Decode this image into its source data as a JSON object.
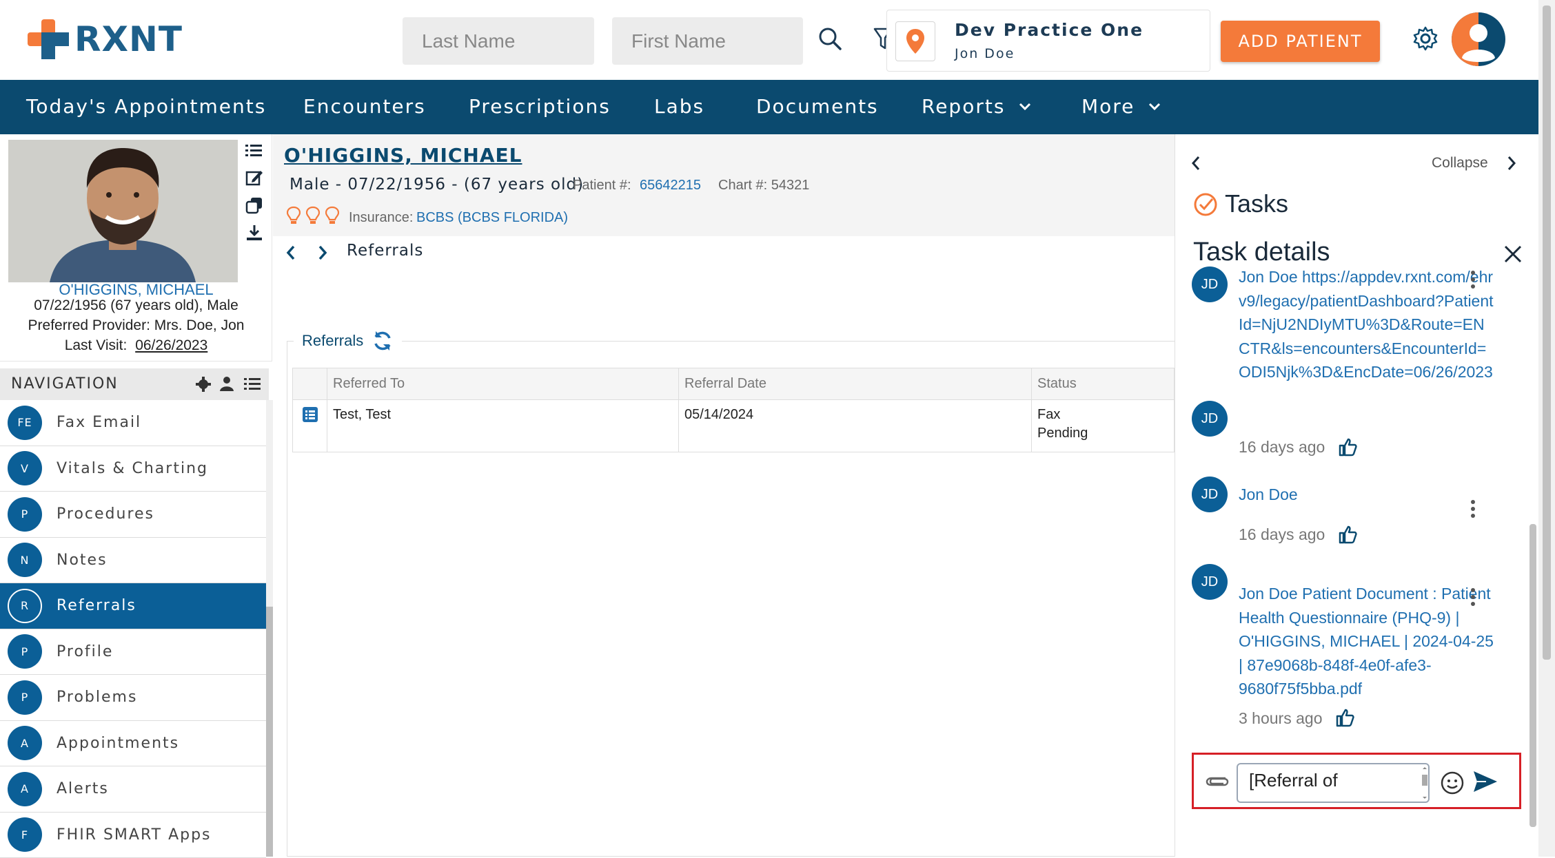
{
  "header": {
    "logo_text": "RXNT",
    "last_name_placeholder": "Last Name",
    "first_name_placeholder": "First Name",
    "practice_name": "Dev Practice One",
    "practice_user": "Jon Doe",
    "add_patient_label": "ADD PATIENT"
  },
  "nav": {
    "items": [
      "Today's Appointments",
      "Encounters",
      "Prescriptions",
      "Labs",
      "Documents",
      "Reports",
      "More"
    ]
  },
  "patient_card": {
    "name": "O'HIGGINS, MICHAEL",
    "dob_line": "07/22/1956 (67 years old), Male",
    "provider_line": "Preferred Provider: Mrs. Doe, Jon",
    "last_visit_label": "Last Visit:",
    "last_visit_value": "06/26/2023"
  },
  "navigation": {
    "title": "NAVIGATION",
    "items": [
      {
        "abbr": "FE",
        "label": "Fax Email"
      },
      {
        "abbr": "V",
        "label": "Vitals & Charting"
      },
      {
        "abbr": "P",
        "label": "Procedures"
      },
      {
        "abbr": "N",
        "label": "Notes"
      },
      {
        "abbr": "R",
        "label": "Referrals"
      },
      {
        "abbr": "P",
        "label": "Profile"
      },
      {
        "abbr": "P",
        "label": "Problems"
      },
      {
        "abbr": "A",
        "label": "Appointments"
      },
      {
        "abbr": "A",
        "label": "Alerts"
      },
      {
        "abbr": "F",
        "label": "FHIR SMART Apps"
      }
    ],
    "active": "Referrals"
  },
  "patient": {
    "name": "O'HIGGINS, MICHAEL",
    "info": "Male - 07/22/1956 - (67 years old)",
    "patient_no_label": "Patient #:",
    "patient_no": "65642215",
    "chart_no": "Chart #: 54321",
    "insurance_label": "Insurance:",
    "insurance_value": "BCBS (BCBS FLORIDA)"
  },
  "breadcrumb": {
    "current": "Referrals"
  },
  "referrals": {
    "title": "Referrals",
    "columns": [
      "Referred To",
      "Referral Date",
      "Status"
    ],
    "rows": [
      {
        "referred_to": "Test, Test",
        "date": "05/14/2024",
        "status_line1": "Fax",
        "status_line2": "Pending"
      }
    ]
  },
  "tasks_panel": {
    "collapse_label": "Collapse",
    "tasks_title": "Tasks",
    "details_title": "Task details",
    "comments": [
      {
        "initials": "JD",
        "text": "Jon Doe https://appdev.rxnt.com/ehrv9/legacy/patientDashboard?PatientId=NjU2NDIyMTU%3D&Route=ENCTR&ls=encounters&EncounterId=ODI5Njk%3D&EncDate=06/26/2023",
        "time": "16 days ago"
      },
      {
        "initials": "JD",
        "text": "Jon Doe",
        "time": "16 days ago"
      },
      {
        "initials": "JD",
        "text": "Jon Doe Patient Document : Patient Health Questionnaire (PHQ-9) | O'HIGGINS, MICHAEL | 2024-04-25 | 87e9068b-848f-4e0f-afe3-9680f75f5bba.pdf",
        "time": "3 hours ago"
      }
    ],
    "compose_value": "[Referral of"
  },
  "colors": {
    "brand_blue": "#0b4a6f",
    "accent_orange": "#f47a3a",
    "link_blue": "#1f6fb0",
    "highlight_red": "#d61f26"
  }
}
